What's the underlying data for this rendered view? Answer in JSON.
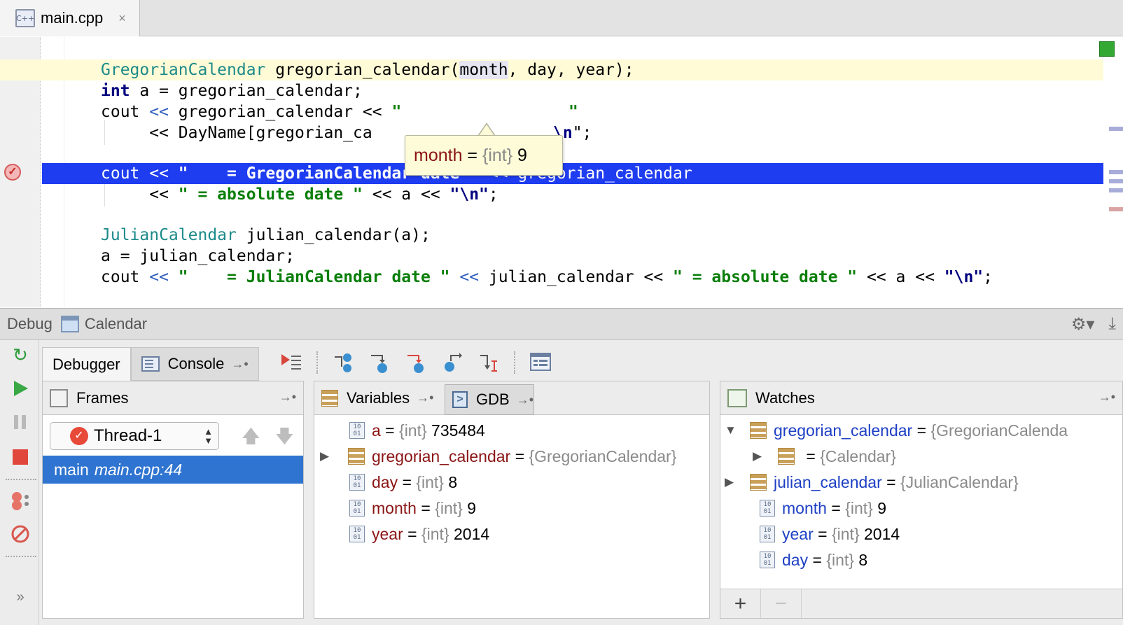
{
  "editor": {
    "tab_label": "main.cpp",
    "tab_icon": "C++",
    "close": "×",
    "lines": {
      "l1_type": "GregorianCalendar",
      "l1_a": " gregorian_calendar(",
      "l1_caret_word": "month",
      "l1_b": ", day, year);",
      "l2_kw": "int",
      "l2_rest": " a = gregorian_calendar;",
      "l3_a": "cout ",
      "l3_op": "<<",
      "l3_b": " gregorian_calendar ",
      "l3_op2": "<<",
      "l3_str": " \"",
      "l3_tail": "\"",
      "l4_a": "     << DayName[gregorian_ca",
      "l4_esc": "\\n",
      "l4_end": "\";",
      "l5_a": "cout << ",
      "l5_str": "\"    = GregorianCalendar date \"",
      "l5_b": " << gregorian_calendar",
      "l6_a": "     << ",
      "l6_str": "\" = absolute date \"",
      "l6_b": " << a << ",
      "l6_esc": "\"\\n\"",
      "l6_end": ";",
      "l7_type": "JulianCalendar",
      "l7_rest": " julian_calendar(a);",
      "l8": "a = julian_calendar;",
      "l9_a": "cout ",
      "l9_op": "<<",
      "l9_str1": " \"    = JulianCalendar date \"",
      "l9_op2": " <<",
      "l9_b": " julian_calendar << ",
      "l9_str2": "\" = absolute date \"",
      "l9_c": " << a << ",
      "l9_esc": "\"\\n\"",
      "l9_end": ";"
    },
    "tooltip": {
      "name": "month",
      "eq": " = ",
      "type": "{int}",
      "value": " 9"
    }
  },
  "debug": {
    "title": "Debug",
    "config": "Calendar",
    "tabs": {
      "debugger": "Debugger",
      "console": "Console"
    },
    "frames": {
      "title": "Frames",
      "thread": "Thread-1",
      "frame_func": "main",
      "frame_loc": "main.cpp:44"
    },
    "variables": {
      "title": "Variables",
      "gdb_tab": "GDB",
      "gdb_icon": ">",
      "rows": [
        {
          "name": "a",
          "eq": " = ",
          "type": "{int}",
          "value": " 735484"
        },
        {
          "name": "gregorian_calendar",
          "eq": " = ",
          "type": "{GregorianCalendar}",
          "value": ""
        },
        {
          "name": "day",
          "eq": " = ",
          "type": "{int}",
          "value": " 8"
        },
        {
          "name": "month",
          "eq": " = ",
          "type": "{int}",
          "value": " 9"
        },
        {
          "name": "year",
          "eq": " = ",
          "type": "{int}",
          "value": " 2014"
        }
      ]
    },
    "watches": {
      "title": "Watches",
      "rows": [
        {
          "name": "gregorian_calendar",
          "eq": " = ",
          "type": "{GregorianCalenda",
          "value": ""
        },
        {
          "name": "",
          "eq": " = ",
          "type": "{Calendar}",
          "value": ""
        },
        {
          "name": "julian_calendar",
          "eq": " = ",
          "type": "{JulianCalendar}",
          "value": ""
        },
        {
          "name": "month",
          "eq": " = ",
          "type": "{int}",
          "value": " 9"
        },
        {
          "name": "year",
          "eq": " = ",
          "type": "{int}",
          "value": " 2014"
        },
        {
          "name": "day",
          "eq": " = ",
          "type": "{int}",
          "value": " 8"
        }
      ],
      "add": "+",
      "remove": "−"
    },
    "icons": {
      "prim": "10\n01",
      "expanded": "▼",
      "collapsed": "▶",
      "pin": "→•",
      "gear": "⚙▾",
      "download": "⤓",
      "more": "»"
    }
  },
  "colors": {
    "breakpoint_line": "#1f3df0",
    "current_line": "#fffbd6",
    "selected_frame": "#2f74d0",
    "variable_name": "#8a1414",
    "watch_name": "#1d3fc4"
  }
}
